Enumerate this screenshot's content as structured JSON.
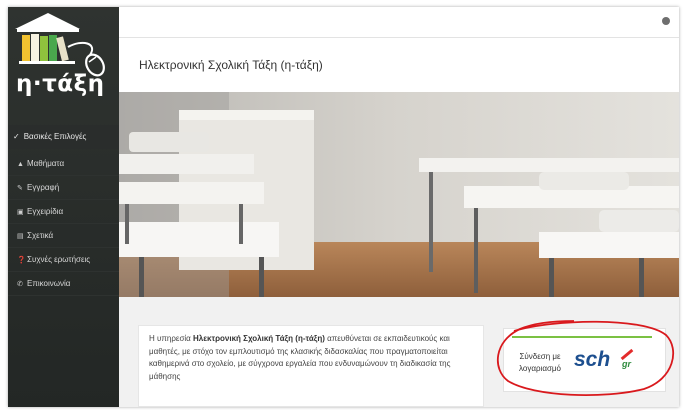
{
  "app": {
    "logo_text": "η·τάξη"
  },
  "sidebar": {
    "section_header": "Βασικές Επιλογές",
    "items": [
      {
        "label": "Μαθήματα",
        "icon": "graduation-cap-icon"
      },
      {
        "label": "Εγγραφή",
        "icon": "edit-icon"
      },
      {
        "label": "Εγχειρίδια",
        "icon": "file-icon"
      },
      {
        "label": "Σχετικά",
        "icon": "credit-card-icon"
      },
      {
        "label": "Συχνές ερωτήσεις",
        "icon": "question-circle-icon"
      },
      {
        "label": "Επικοινωνία",
        "icon": "phone-icon"
      }
    ]
  },
  "header": {
    "page_title": "Ηλεκτρονική Σχολική Τάξη (η-τάξη)"
  },
  "intro": {
    "text_before": "Η υπηρεσία ",
    "bold": "Ηλεκτρονική Σχολική Τάξη (η-τάξη)",
    "text_after": " απευθύνεται σε εκπαιδευτικούς και μαθητές, με στόχο τον εμπλουτισμό της κλασικής διδασκαλίας που πραγματοποιείται καθημερινά στο σχολείο, με σύγχρονα εργαλεία που ενδυναμώνουν τη διαδικασία της μάθησης"
  },
  "login": {
    "label": "Σύνδεση με λογαριασμό",
    "brand": "sch",
    "brand_suffix": "gr"
  },
  "colors": {
    "sidebar_bg": "#2b2f2d",
    "accent_green": "#7bc143",
    "sch_blue": "#1d4f8f",
    "annotation_red": "#d9191d"
  }
}
